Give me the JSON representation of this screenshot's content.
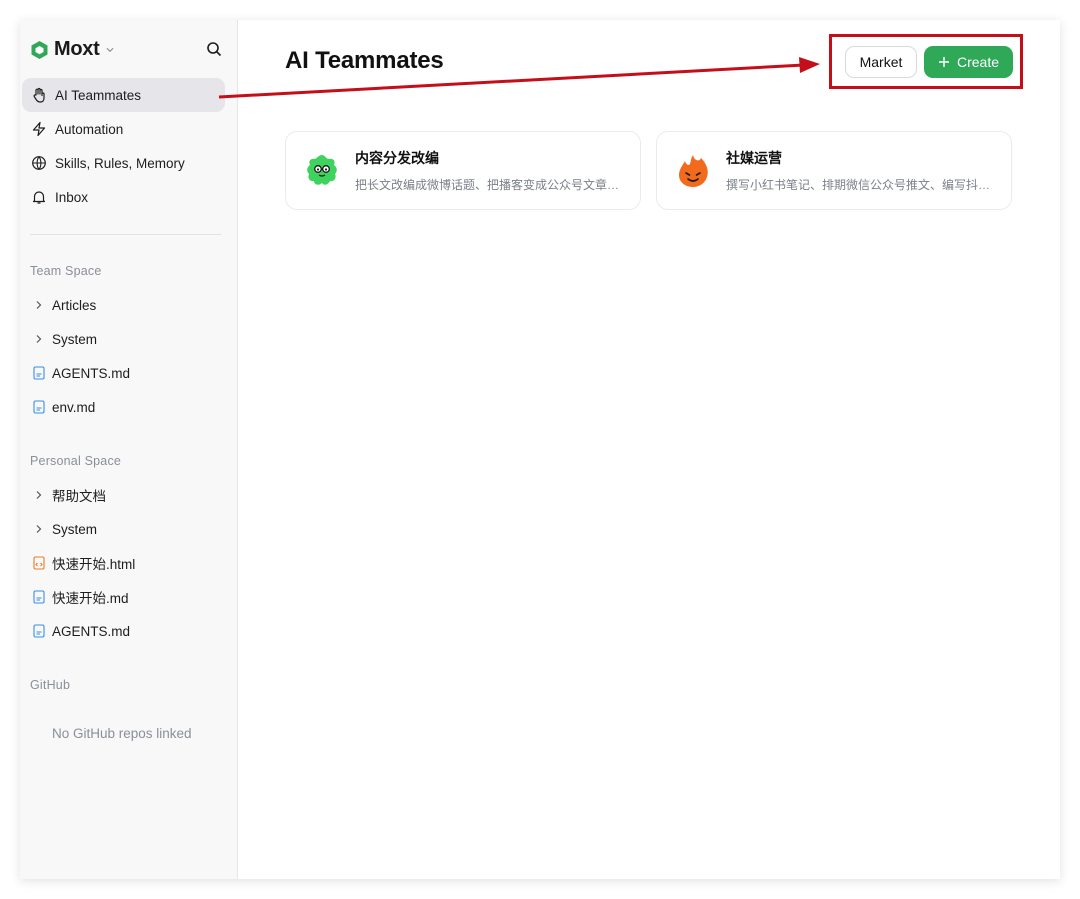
{
  "app": {
    "name": "Moxt"
  },
  "sidebar": {
    "nav": [
      {
        "label": "AI Teammates",
        "icon": "hand-icon",
        "active": true
      },
      {
        "label": "Automation",
        "icon": "lightning-icon",
        "active": false
      },
      {
        "label": "Skills, Rules, Memory",
        "icon": "globe-icon",
        "active": false
      },
      {
        "label": "Inbox",
        "icon": "bell-icon",
        "active": false
      }
    ],
    "team_space": {
      "title": "Team Space",
      "items": [
        {
          "label": "Articles",
          "type": "folder"
        },
        {
          "label": "System",
          "type": "folder"
        },
        {
          "label": "AGENTS.md",
          "type": "md-file"
        },
        {
          "label": "env.md",
          "type": "md-file"
        }
      ]
    },
    "personal_space": {
      "title": "Personal Space",
      "items": [
        {
          "label": "帮助文档",
          "type": "folder"
        },
        {
          "label": "System",
          "type": "folder"
        },
        {
          "label": "快速开始.html",
          "type": "html-file"
        },
        {
          "label": "快速开始.md",
          "type": "md-file"
        },
        {
          "label": "AGENTS.md",
          "type": "md-file"
        }
      ]
    },
    "github": {
      "title": "GitHub",
      "empty": "No GitHub repos linked"
    }
  },
  "main": {
    "title": "AI Teammates",
    "market_label": "Market",
    "create_label": "Create",
    "cards": [
      {
        "title": "内容分发改编",
        "desc": "把长文改编成微博话题、把播客变成公众号文章…",
        "avatar": "green-blob-avatar"
      },
      {
        "title": "社媒运营",
        "desc": "撰写小红书笔记、排期微信公众号推文、编写抖…",
        "avatar": "orange-flame-avatar"
      }
    ]
  },
  "colors": {
    "accent": "#2fa957",
    "annotation": "#c40f1a",
    "active_nav": "#e6e6ea",
    "md_icon": "#3a8ee6",
    "html_icon": "#ef7a22"
  }
}
